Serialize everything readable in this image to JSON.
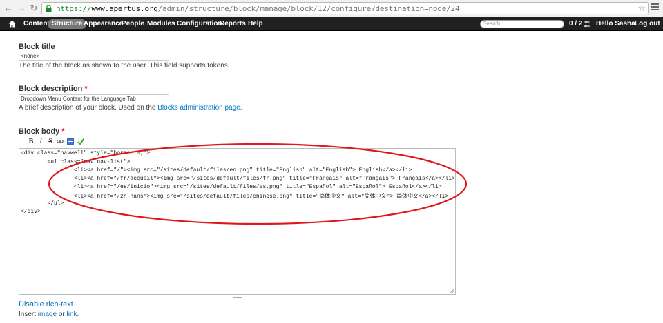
{
  "browser": {
    "url_protocol": "https://",
    "url_host": "www.apertus.org",
    "url_path": "/admin/structure/block/manage/block/12/configure?destination=node/24"
  },
  "toolbar": {
    "items": [
      "Content",
      "Structure",
      "Appearance",
      "People",
      "Modules",
      "Configuration",
      "Reports",
      "Help"
    ],
    "active": "Structure",
    "search_placeholder": "Search",
    "users_online": "0 / 2",
    "greeting": "Hello Sasha",
    "logout": "Log out"
  },
  "form": {
    "block_title": {
      "label": "Block title",
      "value": "<none>",
      "description": "The title of the block as shown to the user. This field supports tokens."
    },
    "block_description": {
      "label": "Block description",
      "required_mark": "*",
      "value": "Dropdown Menu Content for the Language Tab",
      "description_prefix": "A brief description of your block. Used on the ",
      "description_link": "Blocks administration page",
      "description_suffix": "."
    },
    "block_body": {
      "label": "Block body",
      "required_mark": "*",
      "toolbar_buttons": [
        "B",
        "I",
        "S"
      ],
      "code_lines": [
        "<div class=\"navwell\" style=\"border:0;\">",
        "        <ul class=\"nav nav-list\">",
        "                <li><a href=\"/\"><img src=\"/sites/default/files/en.png\" title=\"English\" alt=\"English\"> English</a></li>",
        "                <li><a href=\"/fr/accueil\"><img src=\"/sites/default/files/fr.png\" title=\"Français\" alt=\"Français\"> Français</a></li>",
        "                <li><a href=\"/es/inicio\"><img src=\"/sites/default/files/es.png\" title=\"Español\" alt=\"Español\"> Español</a></li>",
        "                <li><a href=\"/zh-hans\"><img src=\"/sites/default/files/chinese.png\" title=\"简体中文\" alt=\"简体中文\"> 简体中文</a></li>",
        "        </ul>",
        "</div>"
      ],
      "disable_link": "Disable rich-text",
      "insert_prefix": "Insert ",
      "insert_image": "image",
      "insert_or": " or ",
      "insert_link": "link",
      "insert_suffix": "."
    }
  },
  "colors": {
    "annotation": "#e0161c",
    "link": "#0074bd",
    "toolbar_bg": "#202020",
    "url_protocol": "#1a8a26"
  }
}
